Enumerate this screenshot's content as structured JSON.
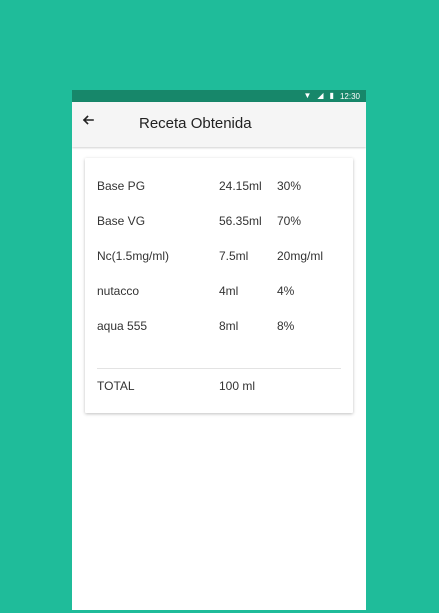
{
  "status_bar": {
    "time": "12:30",
    "wifi_icon": "wifi-icon",
    "signal_icon": "signal-icon",
    "battery_icon": "battery-icon"
  },
  "toolbar": {
    "back_icon": "arrow-back-icon",
    "title": "Receta Obtenida"
  },
  "recipe": {
    "rows": [
      {
        "name": "Base PG",
        "volume": "24.15ml",
        "percent": "30%"
      },
      {
        "name": "Base VG",
        "volume": "56.35ml",
        "percent": "70%"
      },
      {
        "name": "Nc(1.5mg/ml)",
        "volume": "7.5ml",
        "percent": "20mg/ml"
      },
      {
        "name": "nutacco",
        "volume": "4ml",
        "percent": "4%"
      },
      {
        "name": "aqua 555",
        "volume": "8ml",
        "percent": "8%"
      }
    ],
    "total": {
      "label": "TOTAL",
      "volume": "100 ml"
    }
  },
  "colors": {
    "background": "#1fbc9a",
    "status_bar": "#17876a",
    "toolbar": "#f5f5f5"
  }
}
